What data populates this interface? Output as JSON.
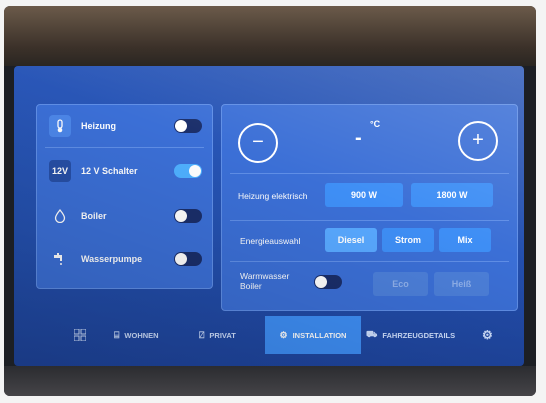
{
  "left_panel": {
    "rows": [
      {
        "icon": "thermometer-icon",
        "label": "Heizung",
        "on": false
      },
      {
        "icon": "12v-icon",
        "icon_text": "12V",
        "label": "12 V Schalter",
        "on": true
      },
      {
        "icon": "droplet-icon",
        "label": "Boiler",
        "on": false
      },
      {
        "icon": "tap-icon",
        "label": "Wasserpumpe",
        "on": false
      }
    ]
  },
  "right_panel": {
    "unit": "°C",
    "temp_value": "-",
    "minus_label": "−",
    "plus_label": "+",
    "electric": {
      "label": "Heizung elektrisch",
      "options": [
        "900 W",
        "1800 W"
      ]
    },
    "energy": {
      "label": "Energieauswahl",
      "options": [
        "Diesel",
        "Strom",
        "Mix"
      ],
      "selected": "Diesel"
    },
    "water": {
      "label": "Warmwasser Boiler",
      "on": false,
      "options": [
        "Eco",
        "Heiß"
      ]
    }
  },
  "nav": {
    "items": [
      "WOHNEN",
      "PRIVAT",
      "INSTALLATION",
      "FAHRZEUGDETAILS"
    ],
    "active": "INSTALLATION"
  },
  "colors": {
    "screen": "#2451b0",
    "panel": "#3b6fd6",
    "accent": "#3e8ef5",
    "toggle_on": "#4fb0ff"
  }
}
